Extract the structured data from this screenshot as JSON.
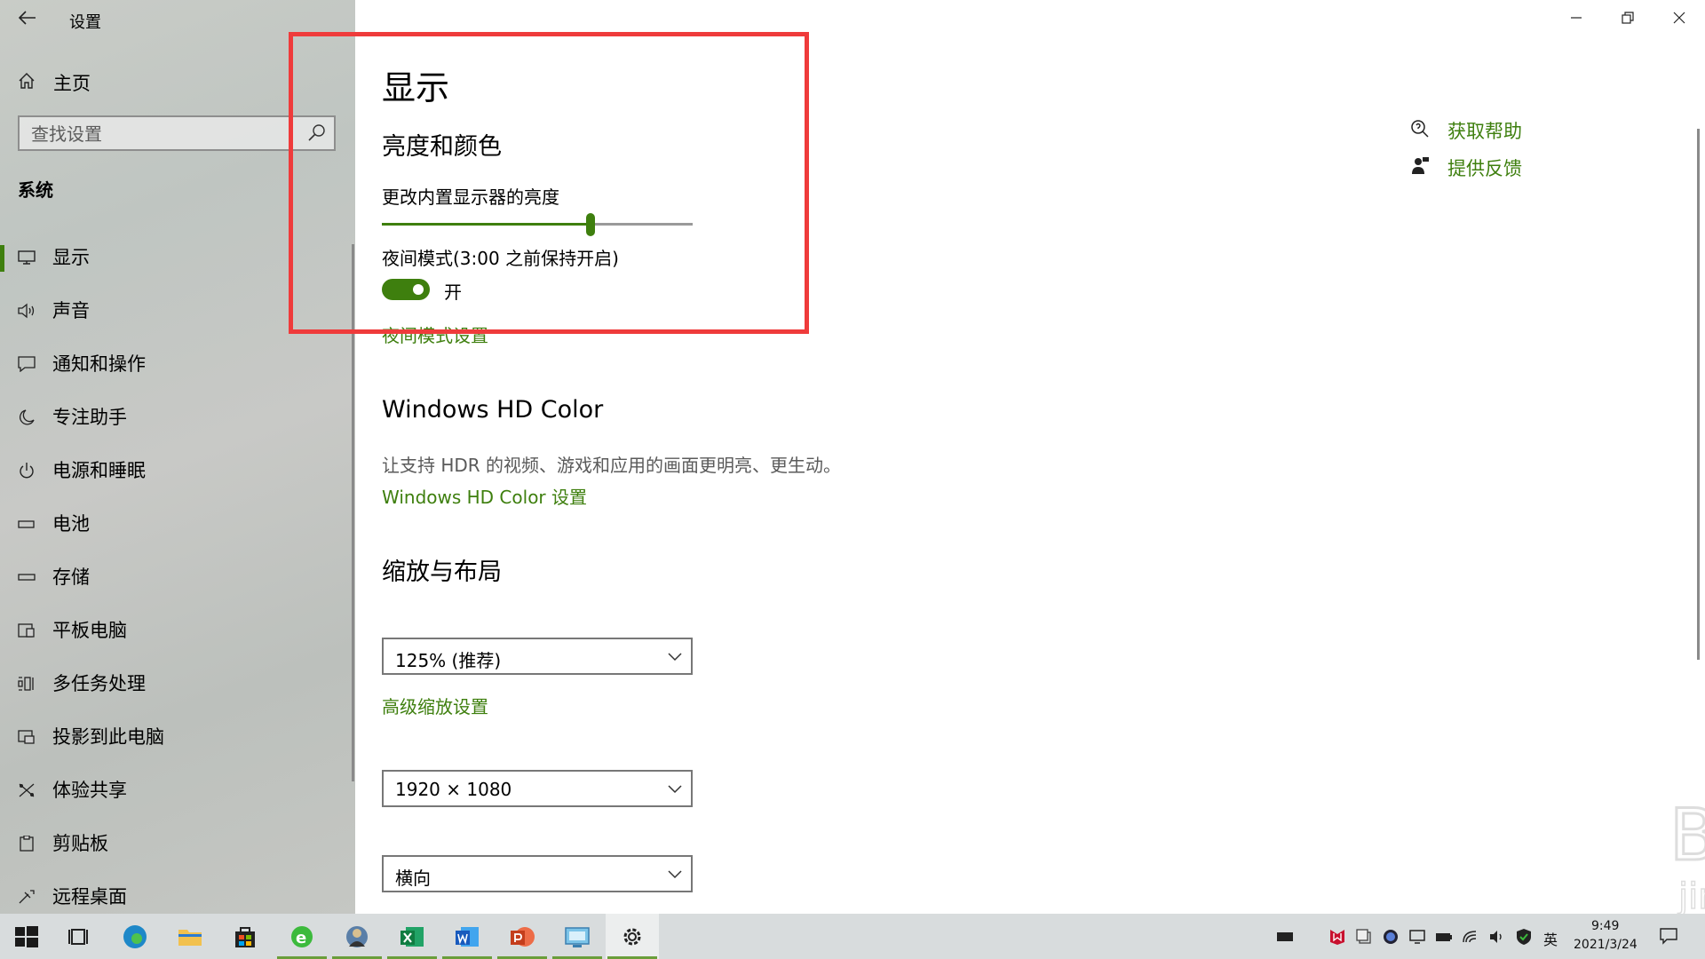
{
  "window": {
    "title": "设置"
  },
  "sidebar": {
    "home_label": "主页",
    "search_placeholder": "查找设置",
    "section_label": "系统",
    "items": [
      {
        "label": "显示",
        "icon": "monitor-icon",
        "active": true
      },
      {
        "label": "声音",
        "icon": "speaker-icon"
      },
      {
        "label": "通知和操作",
        "icon": "message-icon"
      },
      {
        "label": "专注助手",
        "icon": "moon-icon"
      },
      {
        "label": "电源和睡眠",
        "icon": "power-icon"
      },
      {
        "label": "电池",
        "icon": "battery-icon"
      },
      {
        "label": "存储",
        "icon": "drive-icon"
      },
      {
        "label": "平板电脑",
        "icon": "tablet-icon"
      },
      {
        "label": "多任务处理",
        "icon": "multitask-icon"
      },
      {
        "label": "投影到此电脑",
        "icon": "project-icon"
      },
      {
        "label": "体验共享",
        "icon": "share-icon"
      },
      {
        "label": "剪贴板",
        "icon": "clipboard-icon"
      },
      {
        "label": "远程桌面",
        "icon": "remote-icon"
      }
    ]
  },
  "main": {
    "page_title": "显示",
    "brightness": {
      "heading": "亮度和颜色",
      "slider_label": "更改内置显示器的亮度",
      "slider_value_pct": 67
    },
    "night_light": {
      "label": "夜间模式(3:00 之前保持开启)",
      "toggle_state_label": "开",
      "toggle_on": true,
      "settings_link": "夜间模式设置"
    },
    "hdr": {
      "heading": "Windows HD Color",
      "description": "让支持 HDR 的视频、游戏和应用的画面更明亮、更生动。",
      "settings_link": "Windows HD Color 设置"
    },
    "scale": {
      "heading": "缩放与布局",
      "scale_value": "125% (推荐)",
      "advanced_link": "高级缩放设置",
      "resolution_value": "1920 × 1080",
      "orientation_value": "横向"
    }
  },
  "help": {
    "get_help": "获取帮助",
    "feedback": "提供反馈"
  },
  "taskbar": {
    "apps": [
      "start",
      "task-view",
      "edge",
      "file-explorer",
      "store",
      "ie-browser",
      "photo-app",
      "excel",
      "word",
      "powerpoint",
      "remote-app",
      "settings"
    ],
    "ime": "英",
    "time": "9:49",
    "date": "2021/3/24"
  },
  "colors": {
    "accent": "#3e7f0e",
    "highlight": "#ef3b3b"
  }
}
